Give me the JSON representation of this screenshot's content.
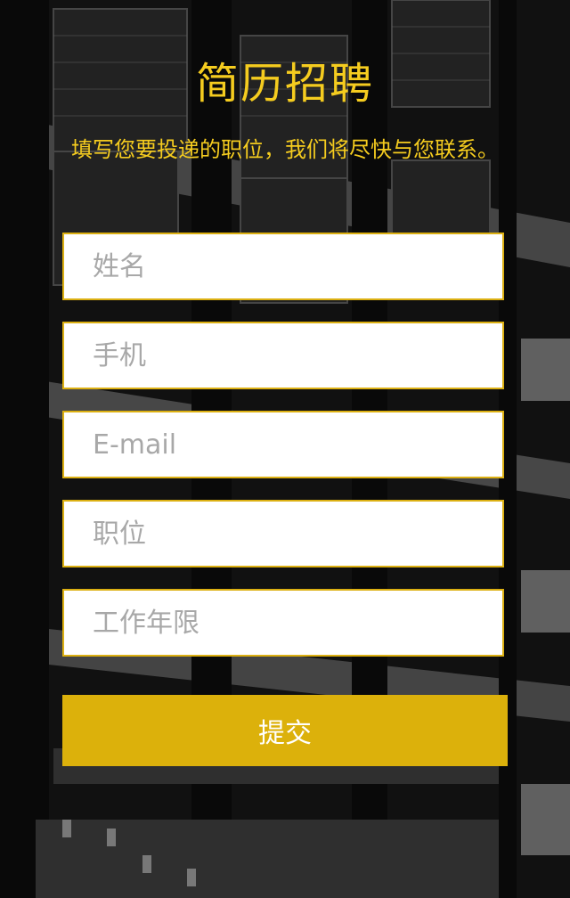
{
  "header": {
    "title": "简历招聘",
    "subtitle": "填写您要投递的职位，我们将尽快与您联系。"
  },
  "form": {
    "fields": [
      {
        "placeholder": "姓名",
        "value": ""
      },
      {
        "placeholder": "手机",
        "value": ""
      },
      {
        "placeholder": "E-mail",
        "value": ""
      },
      {
        "placeholder": "职位",
        "value": ""
      },
      {
        "placeholder": "工作年限",
        "value": ""
      }
    ],
    "submit_label": "提交"
  },
  "colors": {
    "accent": "#dcb10b",
    "title": "#f5cc1f",
    "field_border": "#dcb012"
  }
}
